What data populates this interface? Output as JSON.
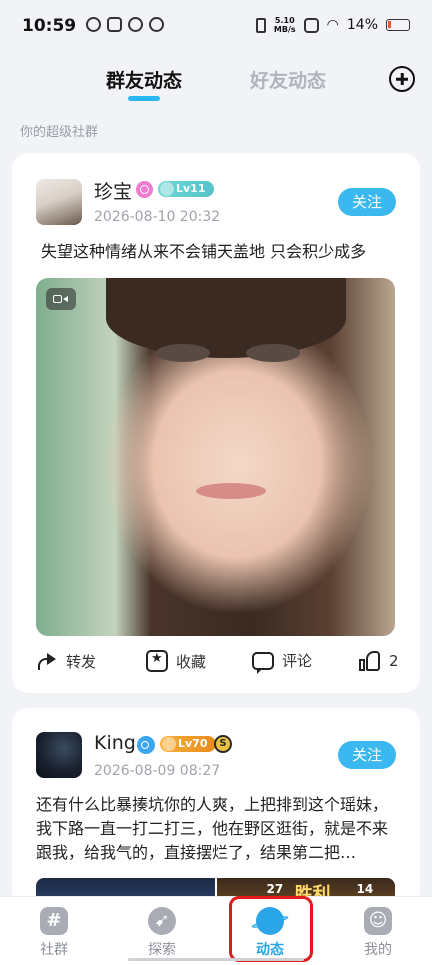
{
  "status_bar": {
    "time": "10:59",
    "net_speed_value": "5.10",
    "net_speed_unit": "MB/s",
    "battery": "14%"
  },
  "header": {
    "tabs": [
      {
        "label": "群友动态",
        "active": true
      },
      {
        "label": "好友动态",
        "active": false
      }
    ],
    "add_icon": "plus-circle-icon"
  },
  "subtitle": "你的超级社群",
  "posts": [
    {
      "username": "珍宝",
      "gender": "female",
      "level": "Lv11",
      "date": "2026-08-10 20:32",
      "follow_label": "关注",
      "text": "失望这种情绪从来不会铺天盖地 只会积少成多",
      "media": "video",
      "actions": {
        "share": "转发",
        "favorite": "收藏",
        "comment": "评论",
        "likes": "2"
      }
    },
    {
      "username": "King",
      "gender": "male",
      "level": "Lv70",
      "badge": "S",
      "date": "2026-08-09 08:27",
      "follow_label": "关注",
      "text": "还有什么比暴揍坑你的人爽，上把排到这个瑶妹，我下路一直一打二打三，他在野区逛街，就是不来跟我，给我气的，直接摆烂了，结果第二把…",
      "thumb_texts": [
        "27",
        "胜利",
        "14"
      ]
    }
  ],
  "bottom_nav": [
    {
      "label": "社群",
      "icon": "hash-icon",
      "active": false
    },
    {
      "label": "探索",
      "icon": "compass-icon",
      "active": false
    },
    {
      "label": "动态",
      "icon": "planet-icon",
      "active": true
    },
    {
      "label": "我的",
      "icon": "face-icon",
      "active": false
    }
  ],
  "colors": {
    "accent": "#2aa5e8",
    "follow_button": "#3cb8f0",
    "highlight_box": "#e11b1b"
  }
}
